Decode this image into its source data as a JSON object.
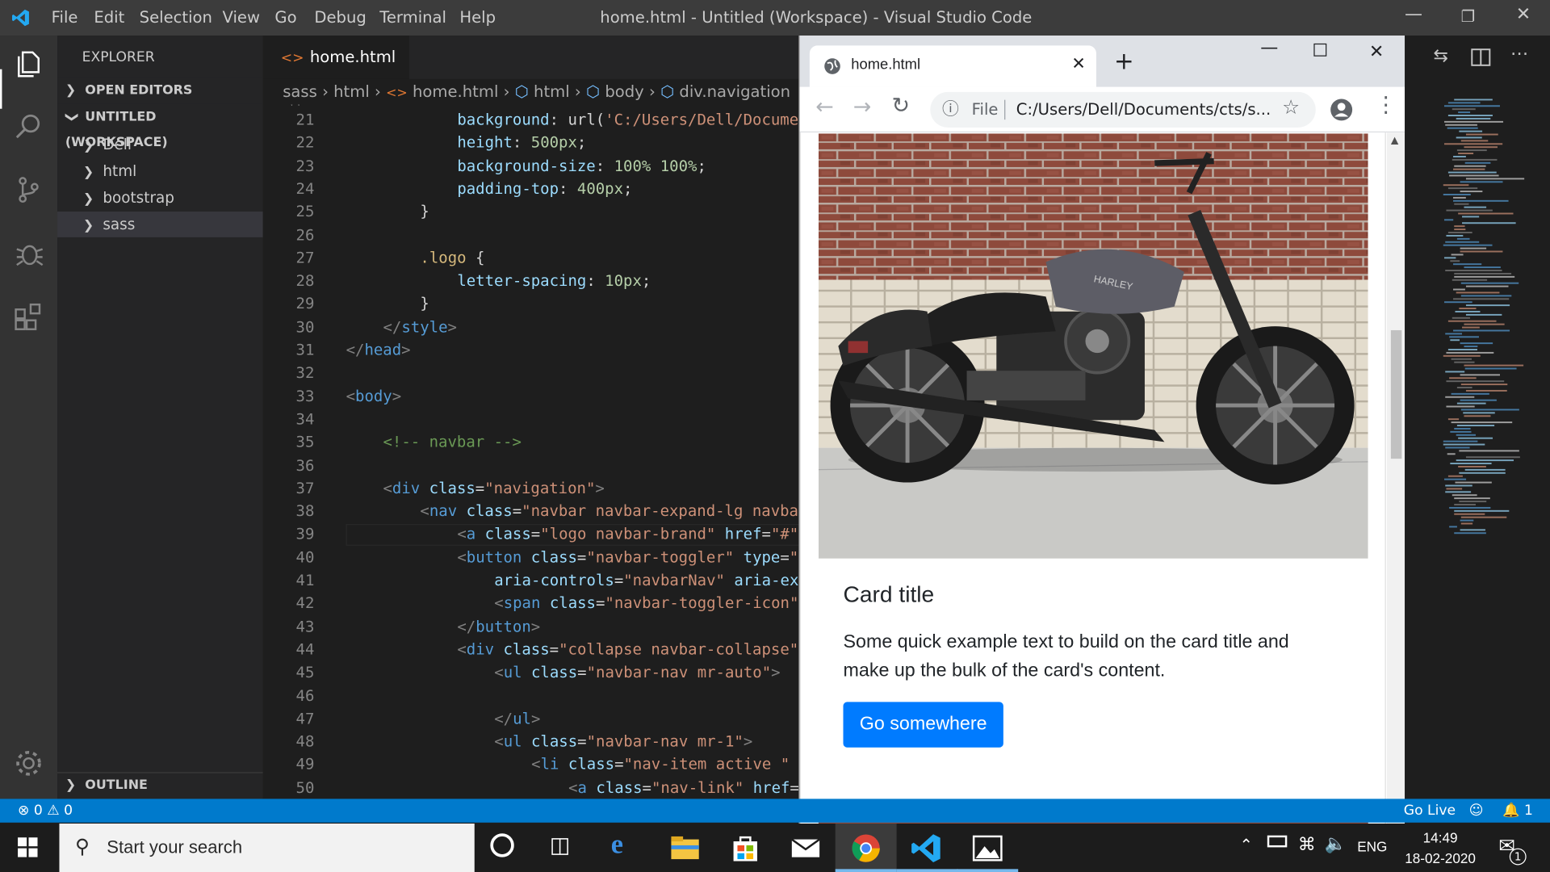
{
  "window": {
    "title": "home.html - Untitled (Workspace) - Visual Studio Code",
    "menu": [
      "File",
      "Edit",
      "Selection",
      "View",
      "Go",
      "Debug",
      "Terminal",
      "Help"
    ]
  },
  "sidebar": {
    "title": "EXPLORER",
    "open_editors": "OPEN EDITORS",
    "workspace": "UNTITLED (WORKSPACE)",
    "folders": [
      "Dell",
      "html",
      "bootstrap",
      "sass"
    ],
    "outline": "OUTLINE"
  },
  "editor": {
    "tab": "home.html",
    "breadcrumb": [
      "sass",
      "html",
      "home.html",
      "html",
      "body",
      "div.navigation"
    ],
    "lines": [
      {
        "n": "21",
        "indent": 3,
        "tokens": [
          [
            "prop",
            "background"
          ],
          [
            "plain",
            ": "
          ],
          [
            "plain",
            "url("
          ],
          [
            "val",
            "'C:/Users/Dell/Docume"
          ]
        ]
      },
      {
        "n": "22",
        "indent": 3,
        "tokens": [
          [
            "prop",
            "height"
          ],
          [
            "plain",
            ": "
          ],
          [
            "num",
            "500px"
          ],
          [
            "plain",
            ";"
          ]
        ]
      },
      {
        "n": "23",
        "indent": 3,
        "tokens": [
          [
            "prop",
            "background-size"
          ],
          [
            "plain",
            ": "
          ],
          [
            "num",
            "100% 100%"
          ],
          [
            "plain",
            ";"
          ]
        ]
      },
      {
        "n": "24",
        "indent": 3,
        "tokens": [
          [
            "prop",
            "padding-top"
          ],
          [
            "plain",
            ": "
          ],
          [
            "num",
            "400px"
          ],
          [
            "plain",
            ";"
          ]
        ]
      },
      {
        "n": "25",
        "indent": 2,
        "tokens": [
          [
            "plain",
            "}"
          ]
        ]
      },
      {
        "n": "26",
        "indent": 0,
        "tokens": []
      },
      {
        "n": "27",
        "indent": 2,
        "tokens": [
          [
            "sel",
            ".logo"
          ],
          [
            "plain",
            " {"
          ]
        ]
      },
      {
        "n": "28",
        "indent": 3,
        "tokens": [
          [
            "prop",
            "letter-spacing"
          ],
          [
            "plain",
            ": "
          ],
          [
            "num",
            "10px"
          ],
          [
            "plain",
            ";"
          ]
        ]
      },
      {
        "n": "29",
        "indent": 2,
        "tokens": [
          [
            "plain",
            "}"
          ]
        ]
      },
      {
        "n": "30",
        "indent": 1,
        "tokens": [
          [
            "punc",
            "</"
          ],
          [
            "tag",
            "style"
          ],
          [
            "punc",
            ">"
          ]
        ]
      },
      {
        "n": "31",
        "indent": 0,
        "tokens": [
          [
            "punc",
            "</"
          ],
          [
            "tag",
            "head"
          ],
          [
            "punc",
            ">"
          ]
        ]
      },
      {
        "n": "32",
        "indent": 0,
        "tokens": []
      },
      {
        "n": "33",
        "indent": 0,
        "tokens": [
          [
            "punc",
            "<"
          ],
          [
            "tag",
            "body"
          ],
          [
            "punc",
            ">"
          ]
        ]
      },
      {
        "n": "34",
        "indent": 0,
        "tokens": []
      },
      {
        "n": "35",
        "indent": 1,
        "tokens": [
          [
            "com",
            "<!-- navbar -->"
          ]
        ]
      },
      {
        "n": "36",
        "indent": 0,
        "tokens": []
      },
      {
        "n": "37",
        "indent": 1,
        "tokens": [
          [
            "punc",
            "<"
          ],
          [
            "tag",
            "div"
          ],
          [
            "plain",
            " "
          ],
          [
            "attr",
            "class"
          ],
          [
            "plain",
            "="
          ],
          [
            "str",
            "\"navigation\""
          ],
          [
            "punc",
            ">"
          ]
        ]
      },
      {
        "n": "38",
        "indent": 2,
        "tokens": [
          [
            "punc",
            "<"
          ],
          [
            "tag",
            "nav"
          ],
          [
            "plain",
            " "
          ],
          [
            "attr",
            "class"
          ],
          [
            "plain",
            "="
          ],
          [
            "str",
            "\"navbar navbar-expand-lg navba"
          ]
        ]
      },
      {
        "n": "39",
        "indent": 3,
        "tokens": [
          [
            "punc",
            "<"
          ],
          [
            "tag",
            "a"
          ],
          [
            "plain",
            " "
          ],
          [
            "attr",
            "class"
          ],
          [
            "plain",
            "="
          ],
          [
            "str",
            "\"logo navbar-brand\""
          ],
          [
            "plain",
            " "
          ],
          [
            "attr",
            "href"
          ],
          [
            "plain",
            "="
          ],
          [
            "str",
            "\"#\""
          ]
        ]
      },
      {
        "n": "40",
        "indent": 3,
        "tokens": [
          [
            "punc",
            "<"
          ],
          [
            "tag",
            "button"
          ],
          [
            "plain",
            " "
          ],
          [
            "attr",
            "class"
          ],
          [
            "plain",
            "="
          ],
          [
            "str",
            "\"navbar-toggler\""
          ],
          [
            "plain",
            " "
          ],
          [
            "attr",
            "type"
          ],
          [
            "plain",
            "="
          ],
          [
            "str",
            "\""
          ]
        ]
      },
      {
        "n": "41",
        "indent": 4,
        "tokens": [
          [
            "attr",
            "aria-controls"
          ],
          [
            "plain",
            "="
          ],
          [
            "str",
            "\"navbarNav\""
          ],
          [
            "plain",
            " "
          ],
          [
            "attr",
            "aria-ex"
          ]
        ]
      },
      {
        "n": "42",
        "indent": 4,
        "tokens": [
          [
            "punc",
            "<"
          ],
          [
            "tag",
            "span"
          ],
          [
            "plain",
            " "
          ],
          [
            "attr",
            "class"
          ],
          [
            "plain",
            "="
          ],
          [
            "str",
            "\"navbar-toggler-icon\""
          ]
        ]
      },
      {
        "n": "43",
        "indent": 3,
        "tokens": [
          [
            "punc",
            "</"
          ],
          [
            "tag",
            "button"
          ],
          [
            "punc",
            ">"
          ]
        ]
      },
      {
        "n": "44",
        "indent": 3,
        "tokens": [
          [
            "punc",
            "<"
          ],
          [
            "tag",
            "div"
          ],
          [
            "plain",
            " "
          ],
          [
            "attr",
            "class"
          ],
          [
            "plain",
            "="
          ],
          [
            "str",
            "\"collapse navbar-collapse\""
          ]
        ]
      },
      {
        "n": "45",
        "indent": 4,
        "tokens": [
          [
            "punc",
            "<"
          ],
          [
            "tag",
            "ul"
          ],
          [
            "plain",
            " "
          ],
          [
            "attr",
            "class"
          ],
          [
            "plain",
            "="
          ],
          [
            "str",
            "\"navbar-nav mr-auto\""
          ],
          [
            "punc",
            ">"
          ]
        ]
      },
      {
        "n": "46",
        "indent": 0,
        "tokens": []
      },
      {
        "n": "47",
        "indent": 4,
        "tokens": [
          [
            "punc",
            "</"
          ],
          [
            "tag",
            "ul"
          ],
          [
            "punc",
            ">"
          ]
        ]
      },
      {
        "n": "48",
        "indent": 4,
        "tokens": [
          [
            "punc",
            "<"
          ],
          [
            "tag",
            "ul"
          ],
          [
            "plain",
            " "
          ],
          [
            "attr",
            "class"
          ],
          [
            "plain",
            "="
          ],
          [
            "str",
            "\"navbar-nav mr-1\""
          ],
          [
            "punc",
            ">"
          ]
        ]
      },
      {
        "n": "49",
        "indent": 5,
        "tokens": [
          [
            "punc",
            "<"
          ],
          [
            "tag",
            "li"
          ],
          [
            "plain",
            " "
          ],
          [
            "attr",
            "class"
          ],
          [
            "plain",
            "="
          ],
          [
            "str",
            "\"nav-item active \""
          ]
        ]
      },
      {
        "n": "50",
        "indent": 6,
        "tokens": [
          [
            "punc",
            "<"
          ],
          [
            "tag",
            "a"
          ],
          [
            "plain",
            " "
          ],
          [
            "attr",
            "class"
          ],
          [
            "plain",
            "="
          ],
          [
            "str",
            "\"nav-link\""
          ],
          [
            "plain",
            " "
          ],
          [
            "attr",
            "href"
          ],
          [
            "plain",
            "="
          ]
        ]
      }
    ]
  },
  "browser": {
    "tab_title": "home.html",
    "file_label": "File",
    "url": "C:/Users/Dell/Documents/cts/s...",
    "card": {
      "title": "Card title",
      "text": "Some quick example text to build on the card title and make up the bulk of the card's content.",
      "button": "Go somewhere"
    }
  },
  "statusbar": {
    "errors": "0",
    "warnings": "0",
    "go_live": "Go Live",
    "notifications": "1"
  },
  "taskbar": {
    "search_placeholder": "Start your search",
    "language": "ENG",
    "time": "14:49",
    "date": "18-02-2020",
    "notification_count": "1"
  }
}
